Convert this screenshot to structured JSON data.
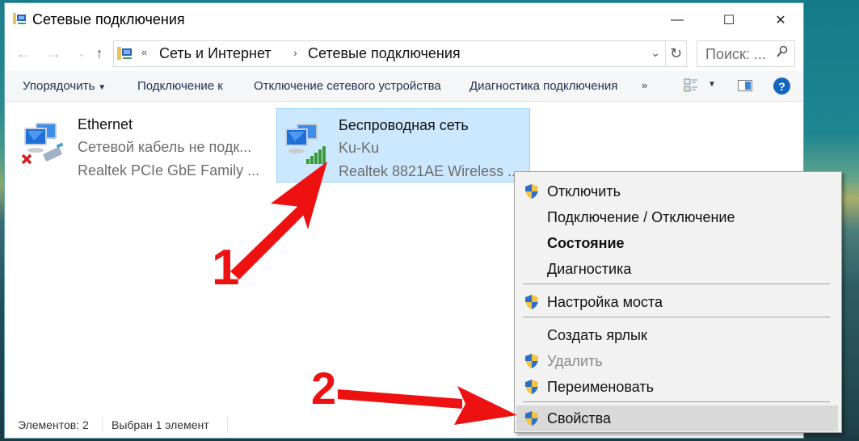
{
  "window": {
    "title": "Сетевые подключения",
    "controls": {
      "minimize": "—",
      "maximize": "☐",
      "close": "✕"
    }
  },
  "nav": {
    "back": "←",
    "forward": "→",
    "recent": "⌄",
    "up": "↑"
  },
  "address": {
    "overflow": "«",
    "breadcrumbs": [
      "Сеть и Интернет",
      "Сетевые подключения"
    ],
    "separator": "›",
    "dropdown": "⌄",
    "refresh": "↻"
  },
  "search": {
    "placeholder": "Поиск: ...",
    "icon": "⚲"
  },
  "commandbar": {
    "organize": "Упорядочить",
    "organize_caret": "▼",
    "connect": "Подключение к",
    "disable": "Отключение сетевого устройства",
    "diagnose": "Диагностика подключения",
    "more": "»",
    "view_caret": "▼",
    "help": "?"
  },
  "connections": [
    {
      "name": "Ethernet",
      "status": "Сетевой кабель не подк...",
      "adapter": "Realtek PCIe GbE Family ...",
      "selected": false,
      "icon": "ethernet-disconnected"
    },
    {
      "name": "Беспроводная сеть",
      "status": "Ku-Ku",
      "adapter": "Realtek 8821AE Wireless ...",
      "selected": true,
      "icon": "wifi-connected"
    }
  ],
  "context_menu": {
    "items": [
      {
        "label": "Отключить",
        "shield": true,
        "bold": false,
        "disabled": false
      },
      {
        "label": "Подключение / Отключение",
        "shield": false,
        "bold": false,
        "disabled": false
      },
      {
        "label": "Состояние",
        "shield": false,
        "bold": true,
        "disabled": false
      },
      {
        "label": "Диагностика",
        "shield": false,
        "bold": false,
        "disabled": false
      },
      {
        "label": "Настройка моста",
        "shield": true,
        "bold": false,
        "disabled": false
      },
      {
        "label": "Создать ярлык",
        "shield": false,
        "bold": false,
        "disabled": false
      },
      {
        "label": "Удалить",
        "shield": true,
        "bold": false,
        "disabled": true
      },
      {
        "label": "Переименовать",
        "shield": true,
        "bold": false,
        "disabled": false
      },
      {
        "label": "Свойства",
        "shield": true,
        "bold": false,
        "disabled": false,
        "highlighted": true
      }
    ]
  },
  "statusbar": {
    "count": "Элементов: 2",
    "selected": "Выбран 1 элемент"
  },
  "annotations": {
    "step1": "1",
    "step2": "2",
    "color": "#ee1111"
  }
}
